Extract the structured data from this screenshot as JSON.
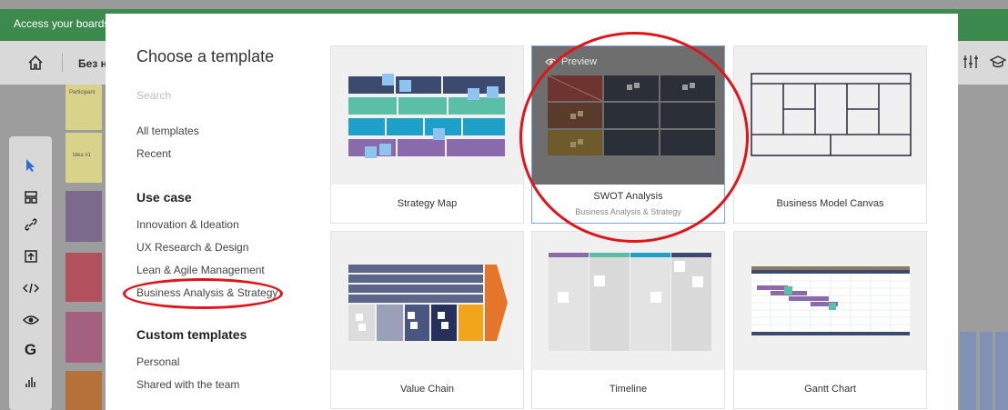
{
  "background": {
    "banner_text": "Access your boards",
    "board_title": "Без наз",
    "stickies": [
      "Participant",
      "Idea #1"
    ]
  },
  "modal": {
    "title": "Choose a template",
    "search_placeholder": "Search",
    "nav": {
      "all_templates": "All templates",
      "recent": "Recent",
      "use_case_heading": "Use case",
      "use_cases": [
        "Innovation & Ideation",
        "UX Research & Design",
        "Lean & Agile Management",
        "Business Analysis & Strategy"
      ],
      "custom_heading": "Custom templates",
      "custom": [
        "Personal",
        "Shared with the team"
      ]
    },
    "preview_label": "Preview",
    "templates": [
      {
        "name": "Strategy Map",
        "subtitle": ""
      },
      {
        "name": "SWOT Analysis",
        "subtitle": "Business Analysis & Strategy"
      },
      {
        "name": "Business Model Canvas",
        "subtitle": ""
      },
      {
        "name": "Value Chain",
        "subtitle": ""
      },
      {
        "name": "Timeline",
        "subtitle": ""
      },
      {
        "name": "Gantt Chart",
        "subtitle": ""
      }
    ]
  },
  "colors": {
    "banner": "#3d8a4f",
    "annotation": "#e0141b",
    "selected_border": "#7ea4e8"
  }
}
